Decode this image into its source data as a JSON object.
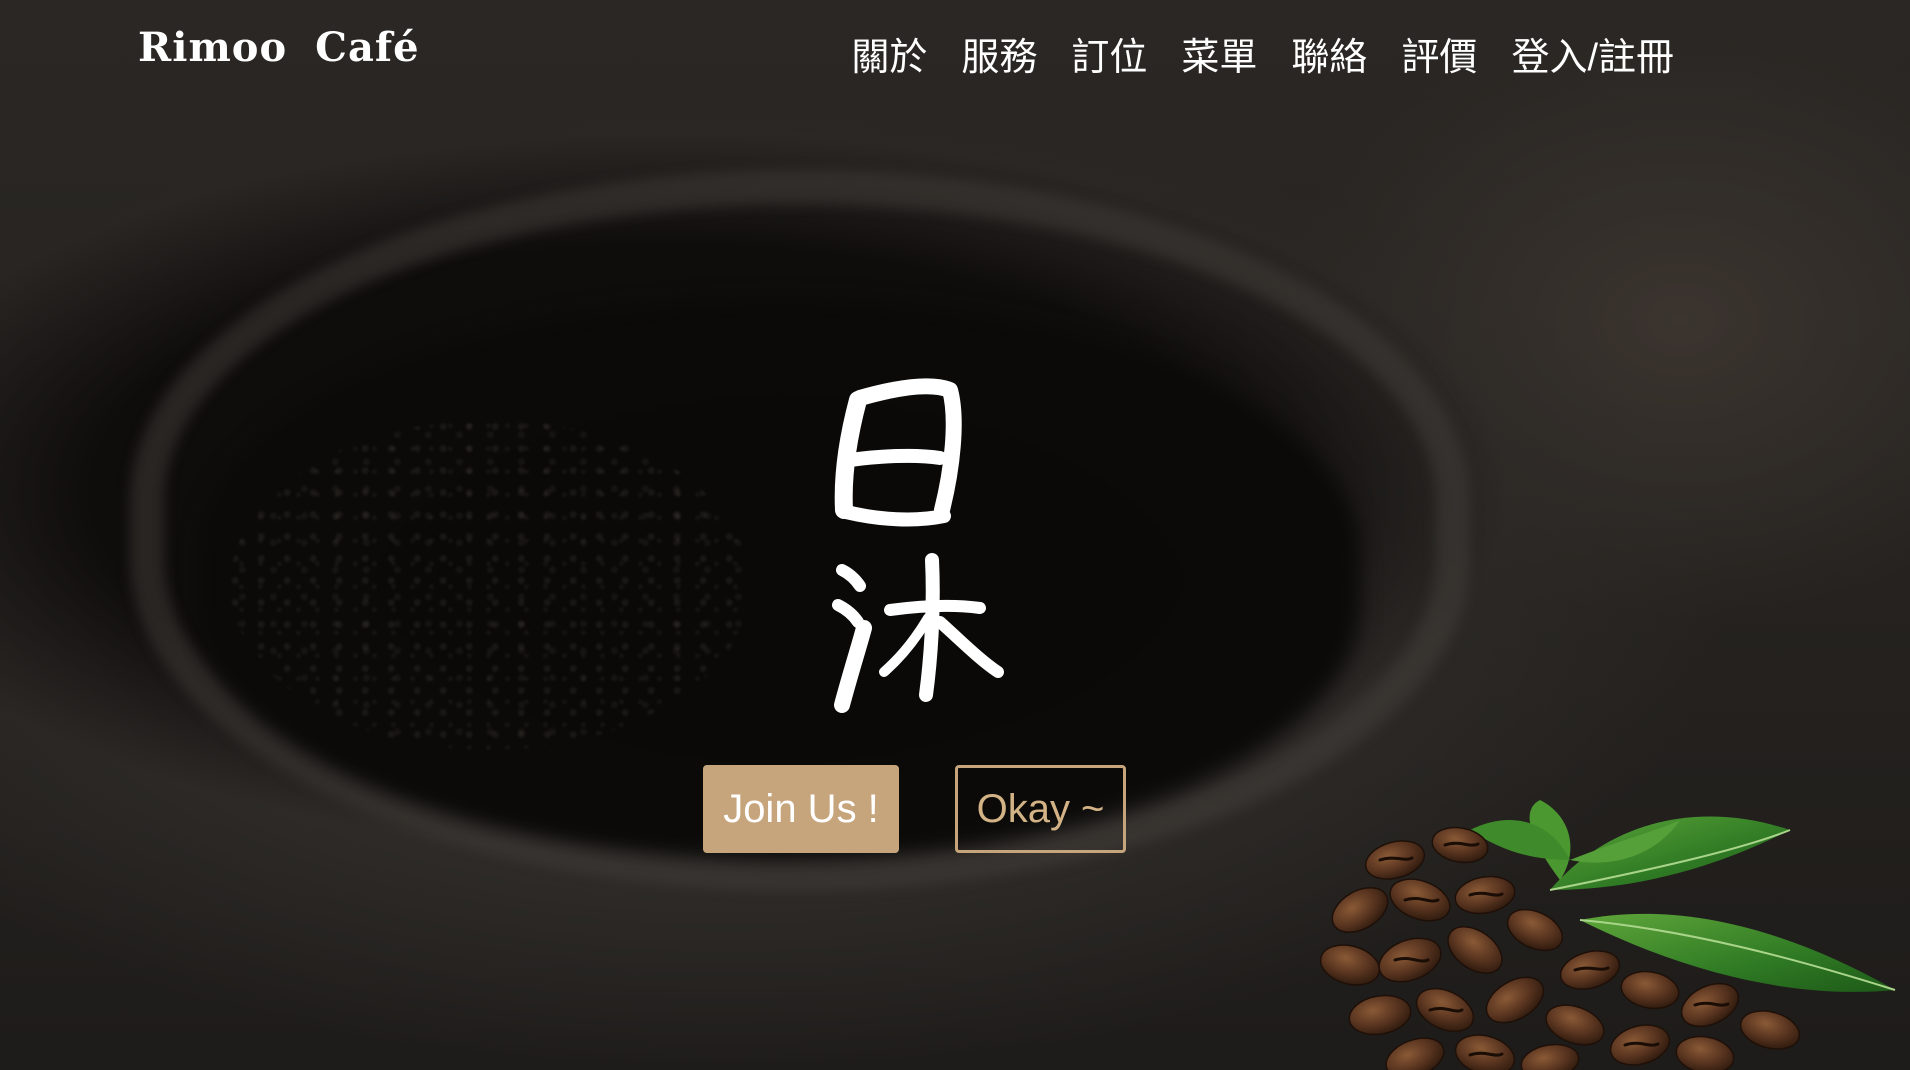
{
  "site": {
    "logo_primary": "Rimoo",
    "logo_secondary": "Café"
  },
  "nav": {
    "items": [
      "關於",
      "服務",
      "訂位",
      "菜單",
      "聯絡",
      "評價",
      "登入/註冊"
    ]
  },
  "hero": {
    "brand_mark_text": "日沐",
    "primary_button": "Join Us !",
    "secondary_button": "Okay ~"
  },
  "colors": {
    "accent": "#c6a57c",
    "text": "#ffffff",
    "background": "#1c1a18"
  },
  "icons": {
    "brand_mark": "calligraphy-logo",
    "decoration": "coffee-beans-leaves"
  }
}
